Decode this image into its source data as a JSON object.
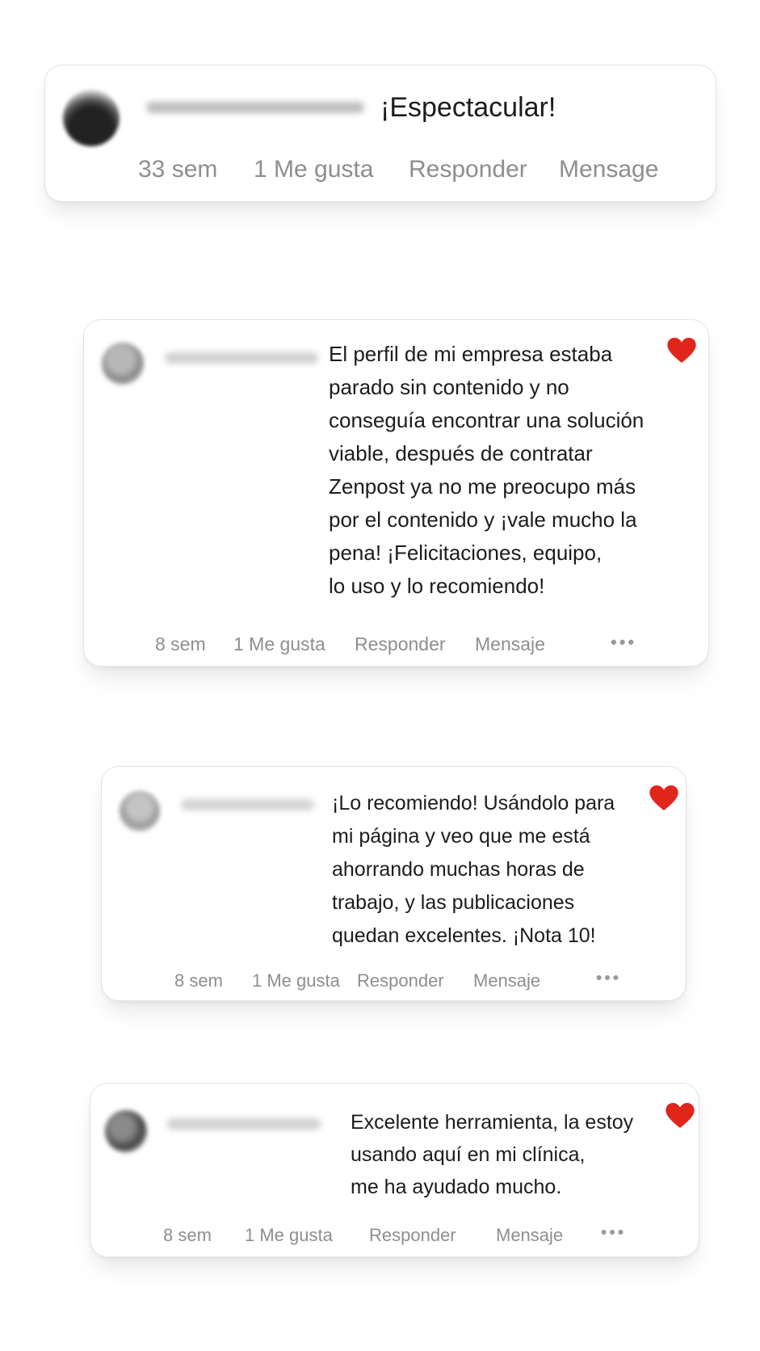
{
  "colors": {
    "heart": "#e0251b",
    "meta_text": "#8e8e8e",
    "comment_text": "#1c1c1c",
    "card_border": "#e3e3e3"
  },
  "comments": [
    {
      "text": "¡Espectacular!",
      "liked": false,
      "meta": {
        "time": "33 sem",
        "likes": "1 Me gusta",
        "reply": "Responder",
        "message": "Mensage"
      }
    },
    {
      "text": "El perfil de mi empresa estaba\nparado sin contenido y no\nconseguía encontrar una solución\nviable, después de contratar\nZenpost ya no me preocupo más\npor el contenido y ¡vale mucho la\npena! ¡Felicitaciones, equipo,\nlo uso y lo recomiendo!",
      "liked": true,
      "meta": {
        "time": "8 sem",
        "likes": "1 Me gusta",
        "reply": "Responder",
        "message": "Mensaje",
        "more": "•••"
      }
    },
    {
      "text": "¡Lo recomiendo! Usándolo para\nmi página y veo que me está\nahorrando muchas horas de\ntrabajo, y las publicaciones\nquedan excelentes. ¡Nota 10!",
      "liked": true,
      "meta": {
        "time": "8 sem",
        "likes": "1 Me gusta",
        "reply": "Responder",
        "message": "Mensaje",
        "more": "•••"
      }
    },
    {
      "text": "Excelente herramienta, la estoy\nusando aquí en mi clínica,\nme ha ayudado mucho.",
      "liked": true,
      "meta": {
        "time": "8 sem",
        "likes": "1 Me gusta",
        "reply": "Responder",
        "message": "Mensaje",
        "more": "•••"
      }
    }
  ]
}
